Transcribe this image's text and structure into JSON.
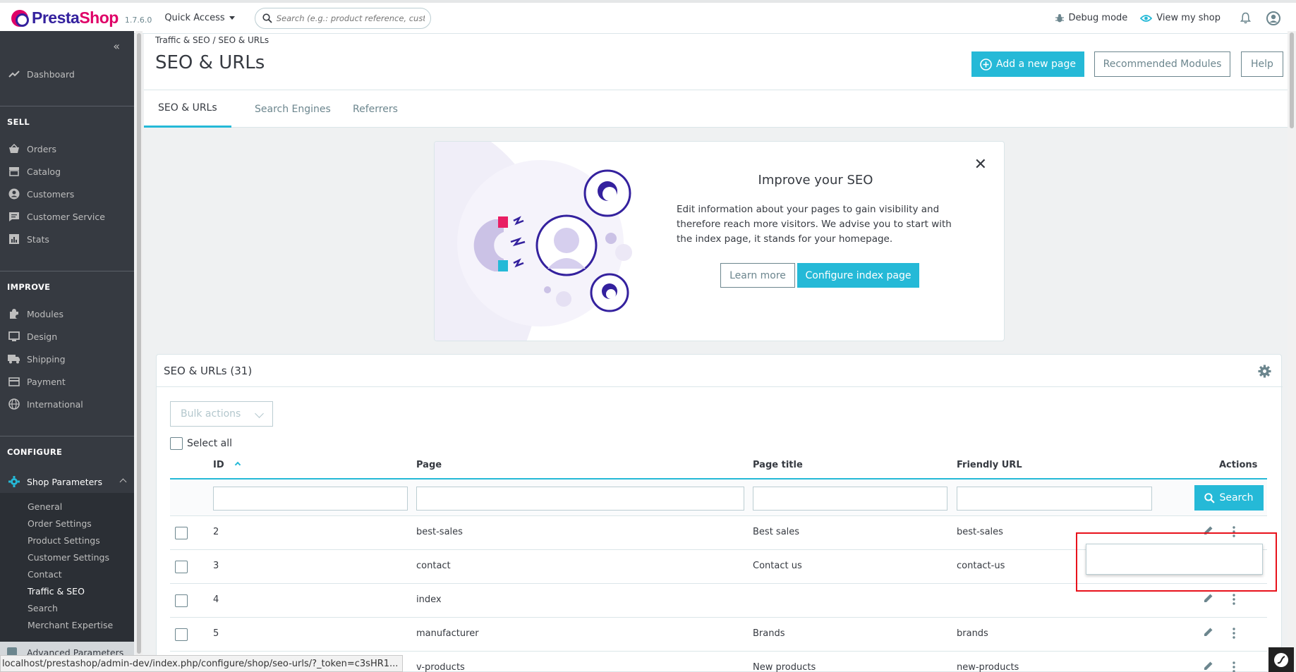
{
  "topbar": {
    "logo_prefix": "Presta",
    "logo_suffix": "Shop",
    "version": "1.7.6.0",
    "quick_access": "Quick Access",
    "search_placeholder": "Search (e.g.: product reference, custome",
    "debug_mode": "Debug mode",
    "view_shop": "View my shop"
  },
  "sidebar": {
    "dashboard": "Dashboard",
    "sell_title": "SELL",
    "sell_items": [
      "Orders",
      "Catalog",
      "Customers",
      "Customer Service",
      "Stats"
    ],
    "improve_title": "IMPROVE",
    "improve_items": [
      "Modules",
      "Design",
      "Shipping",
      "Payment",
      "International"
    ],
    "configure_title": "CONFIGURE",
    "shop_parameters": "Shop Parameters",
    "shop_sub": [
      "General",
      "Order Settings",
      "Product Settings",
      "Customer Settings",
      "Contact",
      "Traffic & SEO",
      "Search",
      "Merchant Expertise"
    ],
    "advanced_parameters": "Advanced Parameters"
  },
  "header": {
    "breadcrumb_parent": "Traffic & SEO",
    "breadcrumb_current": "SEO & URLs",
    "title": "SEO & URLs",
    "add_page": "Add a new page",
    "recommended": "Recommended Modules",
    "help": "Help",
    "tabs": [
      "SEO & URLs",
      "Search Engines",
      "Referrers"
    ]
  },
  "seo_card": {
    "title": "Improve your SEO",
    "text": "Edit information about your pages to gain visibility and therefore reach more visitors. We advise you to start with the index page, it stands for your homepage.",
    "learn_more": "Learn more",
    "configure": "Configure index page"
  },
  "list": {
    "heading": "SEO & URLs (31)",
    "bulk_actions": "Bulk actions",
    "select_all": "Select all",
    "columns": [
      "ID",
      "Page",
      "Page title",
      "Friendly URL",
      "Actions"
    ],
    "search_button": "Search",
    "rows": [
      {
        "id": "2",
        "page": "best-sales",
        "title": "Best sales",
        "url": "best-sales"
      },
      {
        "id": "3",
        "page": "contact",
        "title": "Contact us",
        "url": "contact-us"
      },
      {
        "id": "4",
        "page": "index",
        "title": "",
        "url": ""
      },
      {
        "id": "5",
        "page": "manufacturer",
        "title": "Brands",
        "url": "brands"
      },
      {
        "id": "",
        "page": "v-products",
        "title": "New products",
        "url": "new-products"
      }
    ]
  },
  "status_url": "localhost/prestashop/admin-dev/index.php/configure/shop/seo-urls/?_token=c3sHR1...",
  "colors": {
    "accent": "#25b9d7",
    "sidebar": "#363a41",
    "brand_pink": "#df0067",
    "brand_purple": "#34219e",
    "highlight": "#e8121b"
  }
}
